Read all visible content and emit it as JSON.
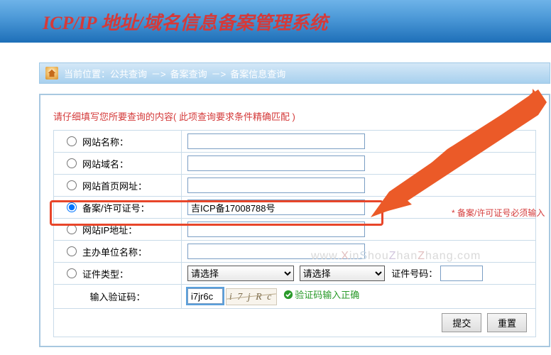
{
  "header": {
    "title": "ICP/IP 地址/域名信息备案管理系统"
  },
  "breadcrumb": {
    "loc_label": "当前位置：",
    "item1": "公共查询",
    "item2": "备案查询",
    "item3": "备案信息查询",
    "sep": "－>"
  },
  "form": {
    "prompt": "请仔细填写您所要查询的内容( 此项查询要求条件精确匹配 )",
    "rows": {
      "site_name": {
        "label": "网站名称：",
        "value": ""
      },
      "site_domain": {
        "label": "网站域名：",
        "value": ""
      },
      "site_url": {
        "label": "网站首页网址：",
        "value": ""
      },
      "record_no": {
        "label": "备案/许可证号：",
        "value": "吉ICP备17008788号",
        "required_note": "* 备案/许可证号必须输入"
      },
      "site_ip": {
        "label": "网站IP地址：",
        "value": ""
      },
      "org_name": {
        "label": "主办单位名称：",
        "value": ""
      },
      "cert_type": {
        "label": "证件类型：",
        "select1": "请选择",
        "select2": "请选择",
        "cert_no_label": "证件号码：",
        "cert_no_value": ""
      },
      "captcha": {
        "label": "输入验证码：",
        "value": "i7jr6c",
        "img_text": "i 7 j R c",
        "ok_text": "验证码输入正确"
      }
    },
    "buttons": {
      "submit": "提交",
      "reset": "重置"
    }
  },
  "watermark": "www.XinShouZhanZhang.com"
}
